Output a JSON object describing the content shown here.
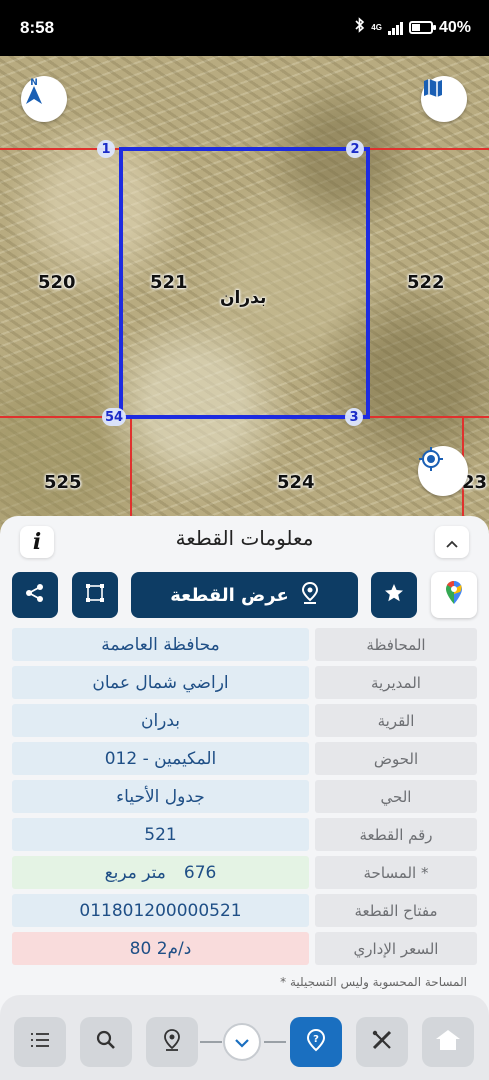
{
  "status_bar": {
    "time": "8:58",
    "network": "4G",
    "battery": "40%"
  },
  "map": {
    "parcel_labels": [
      "520",
      "521",
      "522",
      "525",
      "524",
      "23"
    ],
    "village_label": "بدران",
    "vertices": [
      "1",
      "2",
      "3",
      "54"
    ],
    "boundary_color": "#1d2be0",
    "neighbor_line_color": "#e0312d",
    "north_icon": "north-arrow-icon",
    "layers_icon": "map-layers-icon",
    "locate_icon": "locate-icon"
  },
  "panel": {
    "title": "معلومات القطعة",
    "info_label": "i",
    "view_plot_label": "عرض القطعة",
    "rows": [
      {
        "label": "المحافظة",
        "value": "محافظة العاصمة"
      },
      {
        "label": "المديرية",
        "value": "اراضي شمال عمان"
      },
      {
        "label": "القرية",
        "value": "بدران"
      },
      {
        "label": "الحوض",
        "value": "المكيمين - 012"
      },
      {
        "label": "الحي",
        "value": "جدول الأحياء"
      },
      {
        "label": "رقم القطعة",
        "value": "521"
      },
      {
        "label": "المساحة *",
        "value": "676",
        "unit": "متر مربع"
      },
      {
        "label": "مفتاح القطعة",
        "value": "011801200000521"
      },
      {
        "label": "السعر الإداري",
        "value": "80 د/م2"
      }
    ],
    "footnote": "* المساحة المحسوبة وليس التسجيلية"
  },
  "colors": {
    "primary": "#0d3c64",
    "accent_blue": "#1a6fc0",
    "value_text": "#1f4f86",
    "area_bg": "#e4f3e4",
    "price_bg": "#f9dcdc"
  },
  "toolbar": {
    "items": [
      "list-icon",
      "search-icon",
      "location-pin-icon",
      "chevron-down-icon",
      "help-pin-icon",
      "measure-tools-icon",
      "home-icon"
    ]
  }
}
